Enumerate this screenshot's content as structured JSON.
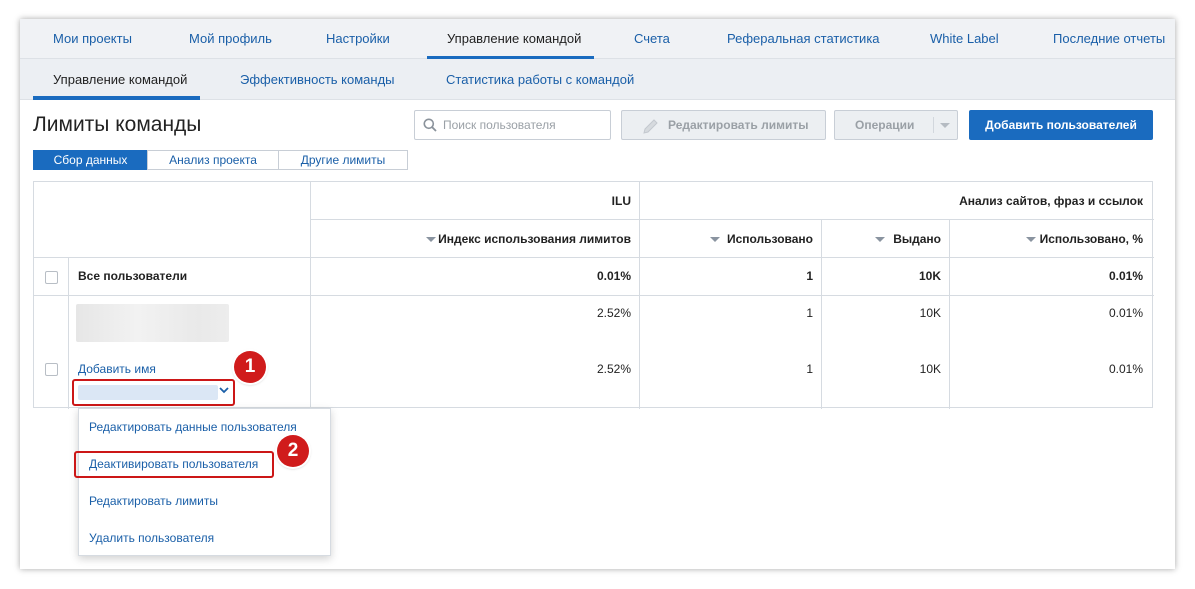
{
  "top_nav": {
    "items": [
      {
        "label": "Мои проекты"
      },
      {
        "label": "Мой профиль"
      },
      {
        "label": "Настройки"
      },
      {
        "label": "Управление командой"
      },
      {
        "label": "Счета"
      },
      {
        "label": "Реферальная статистика"
      },
      {
        "label": "White Label"
      },
      {
        "label": "Последние отчеты"
      }
    ],
    "active_index": 3
  },
  "sub_nav": {
    "items": [
      {
        "label": "Управление командой"
      },
      {
        "label": "Эффективность команды"
      },
      {
        "label": "Статистика работы с командой"
      }
    ],
    "active_index": 0
  },
  "page": {
    "title": "Лимиты команды"
  },
  "toolbar": {
    "search_placeholder": "Поиск пользователя",
    "edit_limits_label": "Редактировать лимиты",
    "operations_label": "Операции",
    "add_users_label": "Добавить пользователей"
  },
  "segments": {
    "items": [
      {
        "label": "Сбор данных"
      },
      {
        "label": "Анализ проекта"
      },
      {
        "label": "Другие лимиты"
      }
    ],
    "active_index": 0
  },
  "table": {
    "group_headers": {
      "ilu": "ILU",
      "analysis": "Анализ сайтов, фраз и ссылок"
    },
    "columns": {
      "ilu_index": "Индекс использования лимитов",
      "used": "Использовано",
      "issued": "Выдано",
      "used_pct": "Использовано, %"
    },
    "all_users": {
      "label": "Все пользователи",
      "ilu_index": "0.01%",
      "used": "1",
      "issued": "10K",
      "used_pct": "0.01%"
    },
    "user_row": {
      "add_name_link": "Добавить имя",
      "line1": {
        "ilu_index": "2.52%",
        "used": "1",
        "issued": "10K",
        "used_pct": "0.01%"
      },
      "line2": {
        "ilu_index": "2.52%",
        "used": "1",
        "issued": "10K",
        "used_pct": "0.01%"
      }
    }
  },
  "context_menu": {
    "items": [
      {
        "label": "Редактировать данные пользователя"
      },
      {
        "label": "Деактивировать пользователя"
      },
      {
        "label": "Редактировать лимиты"
      },
      {
        "label": "Удалить пользователя"
      }
    ]
  },
  "annotations": {
    "badge1": "1",
    "badge2": "2"
  },
  "colors": {
    "accent": "#1a6bbf",
    "link": "#1a5fa8",
    "highlight": "#cc1717",
    "badge": "#d01b1b"
  },
  "icons": [
    "search-icon",
    "pencil-icon",
    "caret-down-icon",
    "chevron-down-icon",
    "sort-arrow-icon"
  ]
}
